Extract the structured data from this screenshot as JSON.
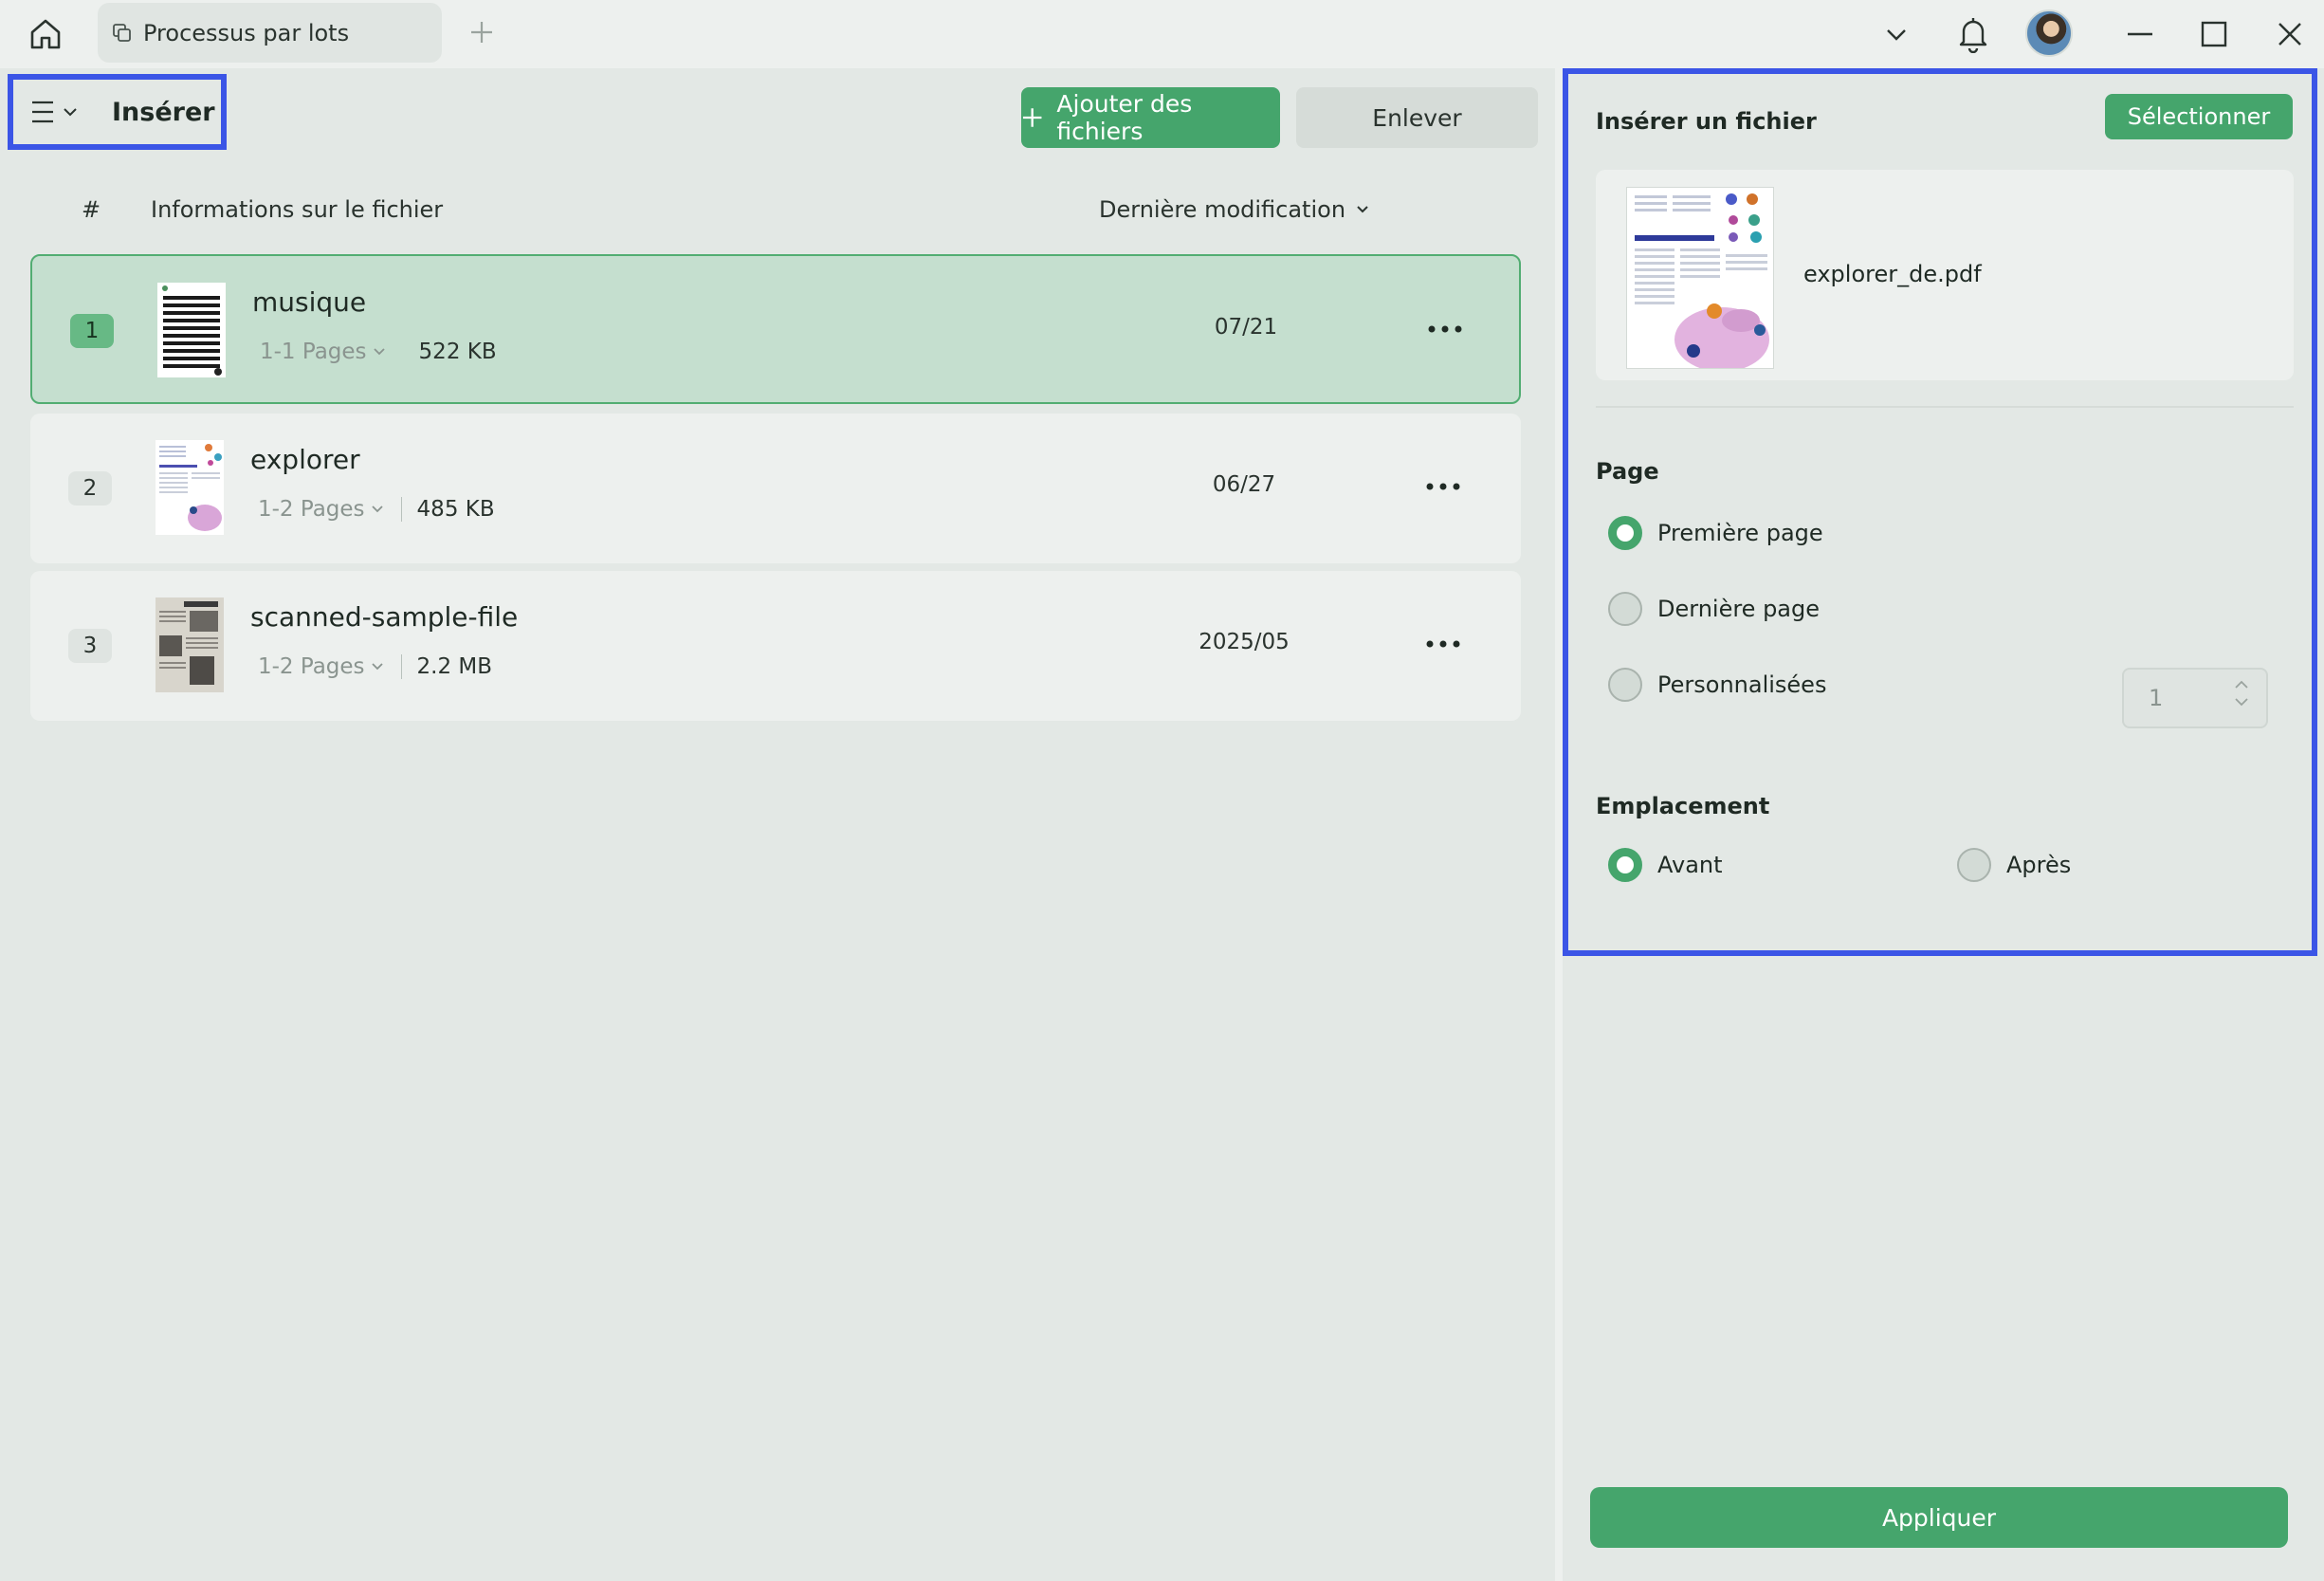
{
  "titlebar": {
    "tab_label": "Processus par lots"
  },
  "toolbar": {
    "mode_title": "Insérer",
    "add_files_label": "Ajouter des fichiers",
    "remove_label": "Enlever"
  },
  "list": {
    "headers": {
      "number": "#",
      "info": "Informations sur le fichier",
      "modified": "Dernière modification"
    },
    "rows": [
      {
        "num": "1",
        "name": "musique",
        "pages": "1-1 Pages",
        "size": "522 KB",
        "date": "07/21",
        "selected": true
      },
      {
        "num": "2",
        "name": "explorer",
        "pages": "1-2 Pages",
        "size": "485 KB",
        "date": "06/27",
        "selected": false
      },
      {
        "num": "3",
        "name": "scanned-sample-file",
        "pages": "1-2 Pages",
        "size": "2.2 MB",
        "date": "2025/05",
        "selected": false
      }
    ]
  },
  "panel": {
    "insert_file_title": "Insérer un fichier",
    "select_label": "Sélectionner",
    "file_name": "explorer_de.pdf",
    "page_title": "Page",
    "page_options": [
      {
        "label": "Première page",
        "checked": true
      },
      {
        "label": "Dernière page",
        "checked": false
      },
      {
        "label": "Personnalisées",
        "checked": false
      }
    ],
    "custom_page_value": "1",
    "location_title": "Emplacement",
    "location_options": [
      {
        "label": "Avant",
        "checked": true
      },
      {
        "label": "Après",
        "checked": false
      }
    ],
    "apply_label": "Appliquer"
  },
  "colors": {
    "accent": "#45a56c",
    "selected_row": "#c5dfcf",
    "highlight_border": "#3b55e6"
  }
}
